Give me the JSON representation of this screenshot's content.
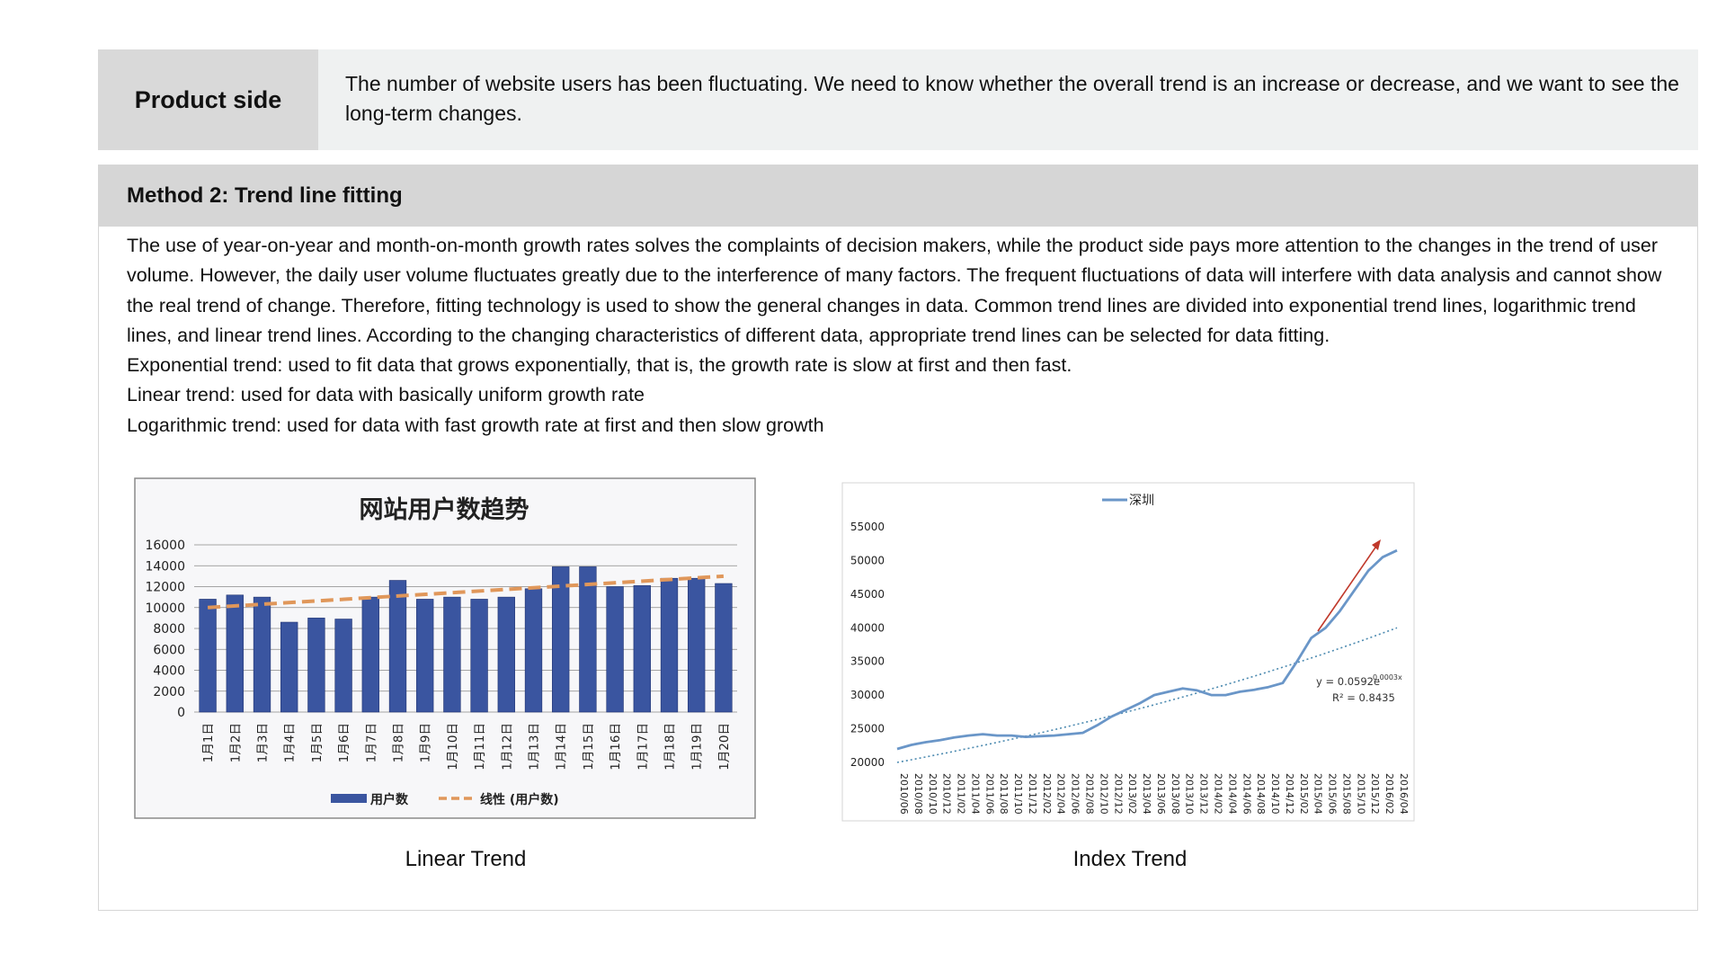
{
  "product": {
    "label": "Product side",
    "text": "The number of website users has been fluctuating. We need to know whether the overall trend is an increase or decrease, and we want to see the long-term changes."
  },
  "method": {
    "title": "Method 2: Trend line fitting",
    "paragraph": "The use of year-on-year and month-on-month growth rates solves the complaints of decision makers, while the product side pays more attention to the changes in the trend of user volume. However, the daily user volume fluctuates greatly due to the interference of many factors. The frequent fluctuations of data will interfere with data analysis and cannot show the real trend of change. Therefore, fitting technology is used to show the general changes in data. Common trend lines are divided into exponential trend lines, logarithmic trend lines, and linear trend lines. According to the changing characteristics of different data, appropriate trend lines can be selected for data fitting.",
    "lines": [
      "Exponential trend: used to fit data that grows exponentially, that is, the growth rate is slow at first and then fast.",
      "Linear trend: used for data with basically uniform growth rate",
      "Logarithmic trend: used for data with fast growth rate at first and then slow growth"
    ]
  },
  "captions": {
    "left": "Linear Trend",
    "right": "Index Trend"
  },
  "chart_data": [
    {
      "type": "bar",
      "title": "网站用户数趋势",
      "categories": [
        "1月1日",
        "1月2日",
        "1月3日",
        "1月4日",
        "1月5日",
        "1月6日",
        "1月7日",
        "1月8日",
        "1月9日",
        "1月10日",
        "1月11日",
        "1月12日",
        "1月13日",
        "1月14日",
        "1月15日",
        "1月16日",
        "1月17日",
        "1月18日",
        "1月19日",
        "1月20日"
      ],
      "series": [
        {
          "name": "用户数",
          "values": [
            10800,
            11200,
            11000,
            8600,
            9000,
            8900,
            11000,
            12600,
            10800,
            11000,
            10800,
            11000,
            11800,
            13900,
            13900,
            12000,
            12100,
            12800,
            12800,
            12300
          ]
        }
      ],
      "trendline": {
        "name": "线性 (用户数)",
        "start": 10000,
        "end": 13000
      },
      "ylim": [
        0,
        16000
      ],
      "yticks": [
        0,
        2000,
        4000,
        6000,
        8000,
        10000,
        12000,
        14000,
        16000
      ],
      "legend": "bottom",
      "grid": true,
      "colors": {
        "bar": "#3a55a0",
        "trend": "#e0975a"
      }
    },
    {
      "type": "line",
      "legend": "top",
      "series": [
        {
          "name": "深圳",
          "x": [
            "2010/06",
            "2010/08",
            "2010/10",
            "2010/12",
            "2011/02",
            "2011/04",
            "2011/06",
            "2011/08",
            "2011/10",
            "2011/12",
            "2012/02",
            "2012/04",
            "2012/06",
            "2012/08",
            "2012/10",
            "2012/12",
            "2013/02",
            "2013/04",
            "2013/06",
            "2013/08",
            "2013/10",
            "2013/12",
            "2014/02",
            "2014/04",
            "2014/06",
            "2014/08",
            "2014/10",
            "2014/12",
            "2015/02",
            "2015/04",
            "2015/06",
            "2015/08",
            "2015/10",
            "2015/12",
            "2016/02",
            "2016/04"
          ],
          "values": [
            22000,
            22600,
            23000,
            23300,
            23700,
            24000,
            24200,
            24000,
            24000,
            23800,
            23900,
            24000,
            24200,
            24400,
            25500,
            26800,
            27800,
            28800,
            30000,
            30500,
            31000,
            30700,
            30000,
            30000,
            30500,
            30800,
            31200,
            31800,
            35000,
            38500,
            40000,
            42500,
            45500,
            48500,
            50500,
            51500
          ]
        }
      ],
      "trendline": {
        "type": "exponential",
        "equation": "y = 0.0592e",
        "exponent": "0.0003x",
        "r2": "R² = 0.8435",
        "start": 20000,
        "end": 40000
      },
      "ylim": [
        20000,
        55000
      ],
      "yticks": [
        20000,
        25000,
        30000,
        35000,
        40000,
        45000,
        50000,
        55000
      ],
      "colors": {
        "line": "#6a96c8",
        "trend": "#4c8ab0",
        "arrow": "#c0392b"
      }
    }
  ]
}
